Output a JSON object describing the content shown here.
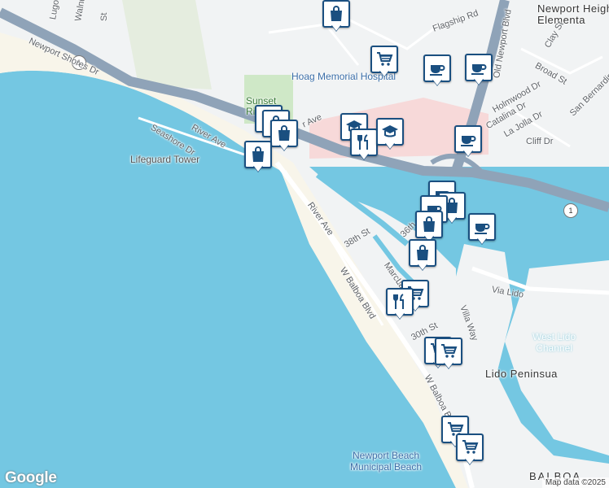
{
  "map": {
    "attribution": "Map data ©2025",
    "logo": "Google",
    "colors": {
      "water": "#74c7e2",
      "land": "#f1f3f4",
      "highway": "#8fa3b8",
      "beach": "#f8f5ea",
      "park": "#cfe8c7",
      "hospital": "#f7d9d9",
      "marker_border": "#1a4f80"
    }
  },
  "labels": {
    "lugo": "Lugo",
    "walnut": "Walnu",
    "st_top": "St",
    "newport_shores_dr": "Newport Shores Dr",
    "flagship_rd": "Flagship Rd",
    "old_newport_blvd": "Old Newport Blvd",
    "newport_heights_elem": "Newport Heigh\nElementa",
    "clay_st": "Clay St",
    "broad_st": "Broad St",
    "hoag_hospital": "Hoag Memorial Hospital",
    "holmwood_dr": "Holmwood Dr",
    "catalina_dr": "Catalina Dr",
    "la_jolla_dr": "La Jolla Dr",
    "san_bernardino": "San Bernardin",
    "sunset_ridge": "Sunset\nRi",
    "river_ave_1": "River Ave",
    "ave_partial": "r Ave",
    "seashore_dr": "Seashore Dr",
    "cliff_dr": "Cliff Dr",
    "lifeguard_tower": "Lifeguard Tower",
    "river_ave_2": "River Ave",
    "st_38th": "38th St",
    "st_36th": "36th",
    "marcus": "Marcus",
    "lake": "Lak",
    "w_balboa_blvd_1": "W Balboa Blvd",
    "via_lido": "Via Lido",
    "villa_way": "Villa Way",
    "st_30th": "30th St",
    "west_lido_channel": "West Lido\nChannel",
    "lido_peninsula": "Lido Peninsua",
    "w_balboa_blvd_2": "W Balboa Blv",
    "newport_beach_municipal": "Newport Beach\nMunicipal Beach",
    "balboa": "BALBOA",
    "route_1_a": "1",
    "route_1_b": "1"
  },
  "markers": [
    {
      "icon": "shopping-bag-icon",
      "label": "shopping"
    },
    {
      "icon": "cart-icon",
      "label": "grocery"
    },
    {
      "icon": "coffee-icon",
      "label": "cafe"
    },
    {
      "icon": "coffee-icon",
      "label": "cafe"
    },
    {
      "icon": "restaurant-icon",
      "label": "restaurant"
    },
    {
      "icon": "shopping-bag-icon",
      "label": "shopping"
    },
    {
      "icon": "shopping-bag-icon",
      "label": "shopping"
    },
    {
      "icon": "school-icon",
      "label": "school"
    },
    {
      "icon": "restaurant-icon",
      "label": "restaurant"
    },
    {
      "icon": "school-icon",
      "label": "school"
    },
    {
      "icon": "coffee-icon",
      "label": "cafe"
    },
    {
      "icon": "shopping-bag-icon",
      "label": "shopping"
    },
    {
      "icon": "coffee-icon",
      "label": "cafe"
    },
    {
      "icon": "shopping-bag-icon",
      "label": "shopping"
    },
    {
      "icon": "coffee-icon",
      "label": "cafe"
    },
    {
      "icon": "shopping-bag-icon",
      "label": "shopping"
    },
    {
      "icon": "shopping-bag-icon",
      "label": "shopping"
    },
    {
      "icon": "coffee-icon",
      "label": "cafe"
    },
    {
      "icon": "cart-icon",
      "label": "grocery"
    },
    {
      "icon": "restaurant-icon",
      "label": "restaurant"
    },
    {
      "icon": "cart-icon",
      "label": "grocery"
    },
    {
      "icon": "cart-icon",
      "label": "grocery"
    },
    {
      "icon": "cart-icon",
      "label": "grocery"
    },
    {
      "icon": "cart-icon",
      "label": "grocery"
    }
  ]
}
